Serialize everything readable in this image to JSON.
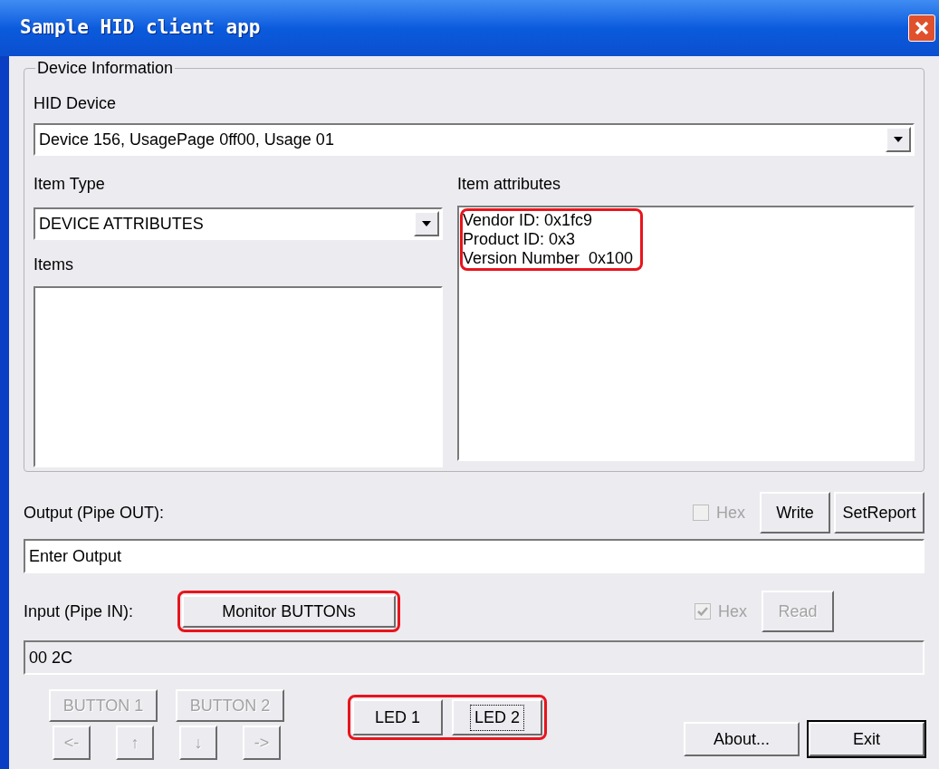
{
  "window": {
    "title": "Sample HID client app"
  },
  "device_information": {
    "title": "Device Information",
    "hid_device": {
      "label": "HID Device",
      "value": "Device 156, UsagePage 0ff00, Usage 01"
    },
    "item_type": {
      "label": "Item Type",
      "value": "DEVICE ATTRIBUTES"
    },
    "items": {
      "label": "Items"
    },
    "item_attributes": {
      "label": "Item attributes",
      "highlighted": true,
      "lines": [
        "Vendor ID: 0x1fc9",
        "Product ID: 0x3",
        "Version Number  0x100"
      ]
    }
  },
  "output": {
    "label": "Output (Pipe OUT):",
    "hex": {
      "label": "Hex",
      "checked": false,
      "disabled": true
    },
    "buttons": [
      {
        "label": "Write",
        "disabled": false
      },
      {
        "label": "SetReport",
        "disabled": false
      }
    ],
    "value": "Enter Output"
  },
  "input": {
    "label": "Input (Pipe IN):",
    "monitor_button": {
      "label": "Monitor BUTTONs",
      "highlighted": true
    },
    "hex": {
      "label": "Hex",
      "checked": true,
      "disabled": true
    },
    "read_button": {
      "label": "Read",
      "disabled": true
    },
    "value": "00 2C"
  },
  "button_pad": {
    "buttons": [
      {
        "label": "BUTTON 1",
        "disabled": true
      },
      {
        "label": "BUTTON 2",
        "disabled": true
      }
    ],
    "arrows": [
      {
        "label": "<-",
        "disabled": true
      },
      {
        "label": "↑",
        "disabled": true
      },
      {
        "label": "↓",
        "disabled": true
      },
      {
        "label": "->",
        "disabled": true
      }
    ]
  },
  "leds": {
    "highlighted": true,
    "buttons": [
      {
        "label": "LED 1",
        "focused": false
      },
      {
        "label": "LED 2",
        "focused": true
      }
    ]
  },
  "dialog_buttons": [
    {
      "label": "About...",
      "default": false
    },
    {
      "label": "Exit",
      "default": true
    }
  ]
}
